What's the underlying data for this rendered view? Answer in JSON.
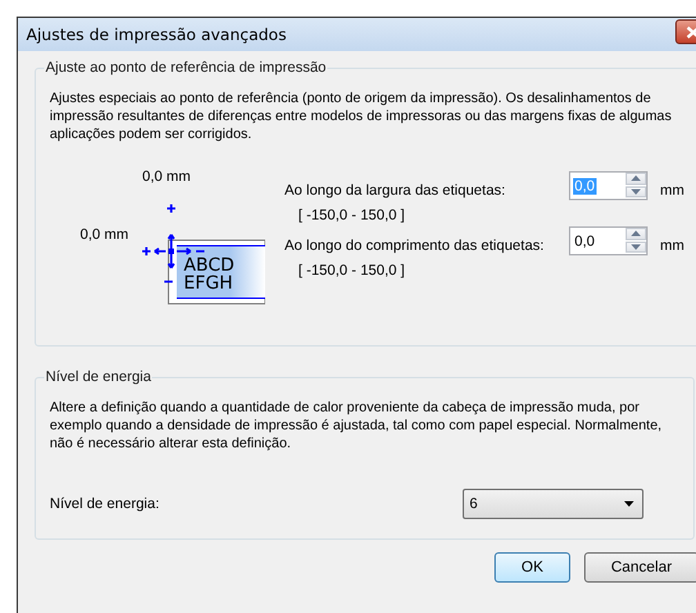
{
  "window": {
    "title": "Ajustes de impressão avançados"
  },
  "reference_group": {
    "legend": "Ajuste ao ponto de referência de impressão",
    "description": "Ajustes especiais ao ponto de referência (ponto de origem da impressão). Os desalinhamentos de impressão resultantes de diferenças entre modelos de impressoras ou das margens fixas de algumas aplicações podem ser corrigidos.",
    "diagram": {
      "top_offset": "0,0 mm",
      "left_offset": "0,0 mm",
      "sample_text": [
        "ABCD",
        "EFGH"
      ]
    },
    "fields": [
      {
        "label": "Ao longo da largura das etiquetas:",
        "range": "[ -150,0 - 150,0 ]",
        "value": "0,0",
        "unit": "mm",
        "focused": true
      },
      {
        "label": "Ao longo do comprimento das etiquetas:",
        "range": "[ -150,0 - 150,0 ]",
        "value": "0,0",
        "unit": "mm",
        "focused": false
      }
    ]
  },
  "energy_group": {
    "legend": "Nível de energia",
    "description": "Altere a definição quando a quantidade de calor proveniente da cabeça de impressão muda, por exemplo quando a densidade de impressão é ajustada, tal como com papel especial. Normalmente, não é necessário alterar esta definição.",
    "label": "Nível de energia:",
    "value": "6"
  },
  "buttons": [
    {
      "label": "OK",
      "default": true
    },
    {
      "label": "Cancelar",
      "default": false
    }
  ]
}
